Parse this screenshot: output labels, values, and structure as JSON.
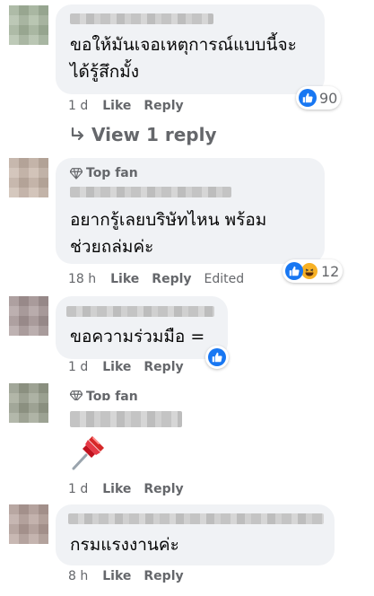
{
  "comments": [
    {
      "text": "ขอให้มันเจอเหตุการณ์แบบนี้จะ\nได้รู้สึกมั้ง",
      "time": "1 d",
      "like_label": "Like",
      "reply_label": "Reply",
      "reaction_count": "90",
      "reactions": [
        "like-icon"
      ],
      "colors": {
        "avatar": "#a8b8a0"
      }
    },
    {
      "badge": "Top fan",
      "text": "อยากรู้เลยบริษัทไหน พร้อม\nช่วยถล่มค่ะ",
      "time": "18 h",
      "like_label": "Like",
      "reply_label": "Reply",
      "edited_label": "Edited",
      "reaction_count": "12",
      "reactions": [
        "like-icon",
        "haha-icon"
      ],
      "colors": {
        "avatar": "#c7b5a8"
      }
    },
    {
      "text": "ขอความร่วมมือ =",
      "time": "1 d",
      "like_label": "Like",
      "reply_label": "Reply",
      "reactions": [
        "like-icon"
      ],
      "colors": {
        "avatar": "#a89898"
      }
    },
    {
      "badge": "Top fan",
      "sticker": "pushpin-icon",
      "time": "1 d",
      "like_label": "Like",
      "reply_label": "Reply",
      "colors": {
        "avatar": "#9aa08e"
      }
    },
    {
      "text": "กรมแรงงานค่ะ",
      "time": "8 h",
      "like_label": "Like",
      "reply_label": "Reply",
      "colors": {
        "avatar": "#b5a09a"
      }
    }
  ],
  "view_replies": {
    "label": "View 1 reply",
    "icon": "reply-arrow-icon"
  },
  "colors": {
    "accent": "#1877f2",
    "bubble": "#f0f2f5",
    "secondary_text": "#65676b"
  }
}
